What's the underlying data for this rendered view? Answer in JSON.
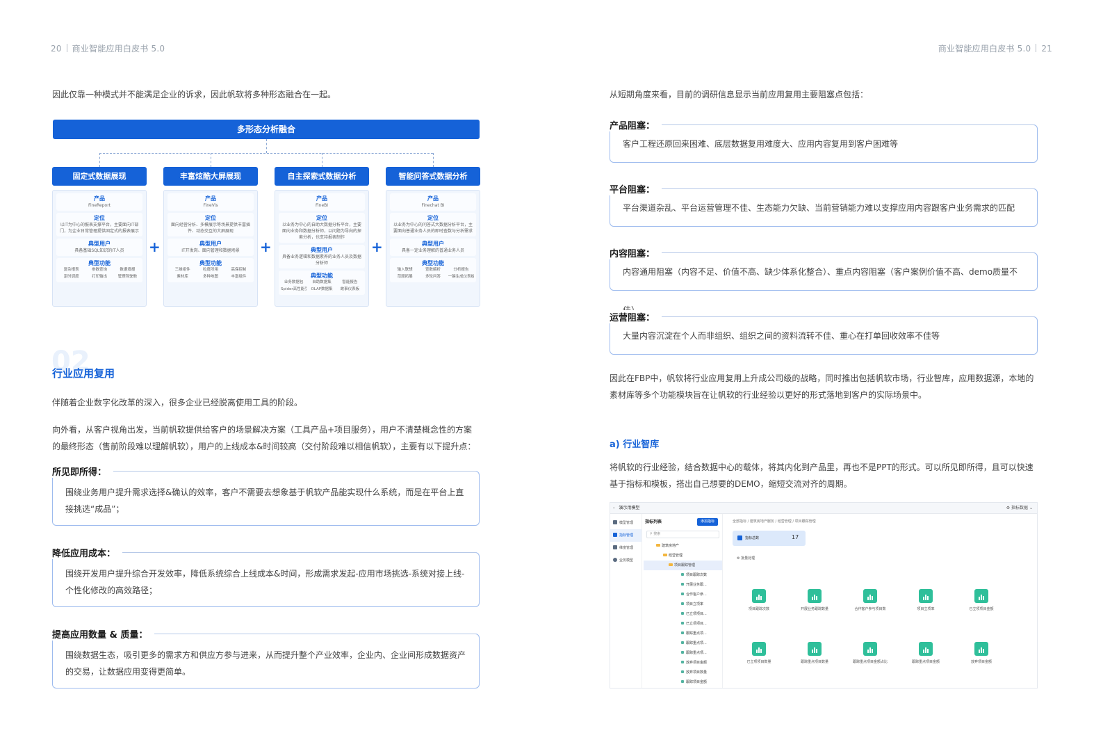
{
  "header": {
    "left_page": "20",
    "left_title": "商业智能应用白皮书 5.0",
    "right_title": "商业智能应用白皮书 5.0",
    "right_page": "21"
  },
  "left": {
    "intro": "因此仅靠一种模式并不能满足企业的诉求，因此帆软将多种形态融合在一起。",
    "diagram": {
      "title": "多形态分析融合",
      "columns": [
        {
          "head": "固定式数据展现",
          "product_t": "产品",
          "product": "FineReport",
          "position_t": "定位",
          "position": "以IT为中心的报表支撑平台，主要面向IT部门，为企业日常管理提供固定式的报表展示",
          "users_t": "典型用户",
          "users": "具备基础SQL知识的IT人员",
          "features_t": "典型功能",
          "features": [
            "复杂报表",
            "参数查询",
            "数据填报",
            "定时调度",
            "打印输出",
            "管理驾驶舱"
          ]
        },
        {
          "head": "丰富炫酷大屏展现",
          "product_t": "产品",
          "product": "FineVis",
          "position_t": "定位",
          "position": "面向经营分析、多模展示等场景提供丰富插件、动态交互的大屏展现",
          "users_t": "典型用户",
          "users": "IT开发岗、面向管理和数据场景",
          "features_t": "典型功能",
          "features": [
            "三维组件",
            "粒度所用",
            "高保控制",
            "素材库",
            "多种地图",
            "丰富组件"
          ]
        },
        {
          "head": "自主探索式数据分析",
          "product_t": "产品",
          "product": "FineBI",
          "position_t": "定位",
          "position": "以业务为中心的自助大数据分析平台，主要面向业务和数据分析师，以问题为导向的探索分析，也支持报表制作",
          "users_t": "典型用户",
          "users": "具备业务逻辑和数据素养的业务人员及数据分析师",
          "features_t": "典型功能",
          "features": [
            "业务数据包",
            "自助数据集",
            "智能报告",
            "Spider高性能引擎",
            "OLAP数据集",
            "故事仪表板"
          ]
        },
        {
          "head": "智能问答式数据分析",
          "product_t": "产品",
          "product": "Finechat BI",
          "position_t": "定位",
          "position": "以业务为中心的问答式大数据分析平台，主要面向普通业务人员的即时查数与分析需求",
          "users_t": "典型用户",
          "users": "具备一定业务理解的普通业务人员",
          "features_t": "典型功能",
          "features": [
            "输入联想",
            "查数解析",
            "分析报告",
            "范题拓展",
            "多轮问答",
            "一键生成仪表板"
          ]
        }
      ]
    },
    "section_num": "02",
    "section_title": "行业应用复用",
    "p1": "伴随着企业数字化改革的深入，很多企业已经脱离使用工具的阶段。",
    "p2": "向外看，从客户视角出发，当前帆软提供给客户的场景解决方案（工具产品+项目服务），用户不清楚概念性的方案的最终形态（售前阶段难以理解帆软），用户的上线成本&时间较高（交付阶段难以相信帆软），主要有以下提升点：",
    "boxes": [
      {
        "label": "所见即所得：",
        "text": "围绕业务用户提升需求选择&确认的效率，客户不需要去想象基于帆软产品能实现什么系统，而是在平台上直接挑选“成品”；"
      },
      {
        "label": "降低应用成本：",
        "text": "围绕开发用户提升综合开发效率，降低系统综合上线成本&时间，形成需求发起-应用市场挑选-系统对接上线-个性化修改的高效路径；"
      },
      {
        "label": "提高应用数量 & 质量：",
        "text": "围绕数据生态，吸引更多的需求方和供应方参与进来，从而提升整个产业效率，企业内、企业间形成数据资产的交易，让数据应用变得更简单。"
      }
    ]
  },
  "right": {
    "intro": "从短期角度来看，目前的调研信息显示当前应用复用主要阻塞点包括：",
    "boxes": [
      {
        "label": "产品阻塞：",
        "text": "客户工程还原回来困难、底层数据复用难度大、应用内容复用到客户困难等"
      },
      {
        "label": "平台阻塞：",
        "text": "平台渠道杂乱、平台运营管理不佳、生态能力欠缺、当前营销能力难以支撑应用内容跟客户业务需求的匹配"
      },
      {
        "label": "内容阻塞：",
        "text": "内容通用阻塞（内容不足、价值不高、缺少体系化整合）、重点内容阻塞（客户案例价值不高、demo质量不佳）"
      },
      {
        "label": "运营阻塞：",
        "text": "大量内容沉淀在个人而非组织、组织之间的资料流转不佳、重心在打单回收效率不佳等"
      }
    ],
    "p_fbp": "因此在FBP中，帆软将行业应用复用上升成公司级的战略，同时推出包括帆软市场，行业智库，应用数据源，本地的素材库等多个功能模块旨在让帆软的行业经验以更好的形式落地到客户的实际场景中。",
    "sub_title": "a) 行业智库",
    "p_think": "将帆软的行业经验，结合数据中心的载体，将其内化到产品里，再也不是PPT的形式。可以所见即所得，且可以快速基于指标和模板，搭出自己想要的DEMO，缩短交流对齐的周期。",
    "screenshot": {
      "top_title": "演示用模型",
      "top_right": "指标数据",
      "nav": [
        "模型管理",
        "指标管理",
        "维度管理",
        "业务模型"
      ],
      "tree_title": "指标列表",
      "tree_button": "添加指标",
      "search_placeholder": "搜索",
      "tree_items": [
        "建筑房地产",
        "经营管理",
        "项目跟踪管理",
        "项目跟踪次数",
        "开展业务跟...",
        "合作客户参...",
        "项目立项率",
        "已立项项目...",
        "已立项项目...",
        "跟踪重点项...",
        "跟踪重点项...",
        "跟踪重点项...",
        "放弃项目金额",
        "放弃项目数量",
        "跟踪项目金额"
      ],
      "breadcrumb": "全部指标 / 建筑房地产服务 / 经营管理 / 项目跟踪管理",
      "stat_label": "指标总数",
      "stat_value": "17",
      "batch": "批量处理",
      "tiles": [
        "项目跟踪次数",
        "开展业务跟踪数量",
        "合作客户参与项目数",
        "项目立项率",
        "已立项项目金额",
        "已立项项目数量",
        "跟踪重点项目数量",
        "跟踪重点项目金额占比",
        "跟踪重点项目金额",
        "放弃项目金额"
      ]
    }
  }
}
